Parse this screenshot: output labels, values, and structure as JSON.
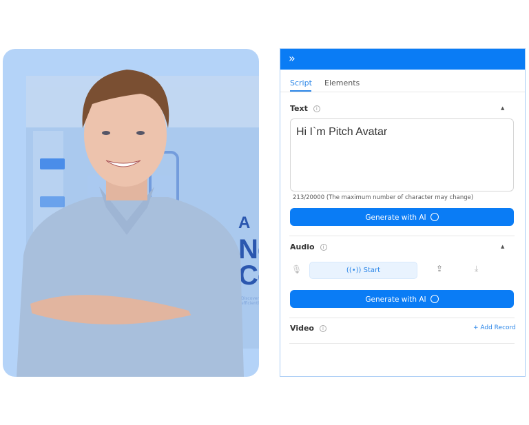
{
  "background_slide": {
    "line1": "Nex",
    "line2": "Cor",
    "caption": "Discovering bu... efficiently.",
    "logo": "A"
  },
  "panel": {
    "collapse_icon": "double-chevron-right-icon",
    "tabs": [
      {
        "label": "Script",
        "active": true
      },
      {
        "label": "Elements",
        "active": false
      }
    ],
    "text_section": {
      "label": "Text",
      "value": "Hi I`m Pitch Avatar",
      "counter": "213/20000 (The maximum number of character may change)",
      "generate_label": "Generate with AI"
    },
    "audio_section": {
      "label": "Audio",
      "start_label": "Start",
      "generate_label": "Generate with AI"
    },
    "video_section": {
      "label": "Video",
      "add_label": "+ Add Record"
    }
  },
  "colors": {
    "accent": "#0a7cf5",
    "card": "#b4d3f8"
  }
}
